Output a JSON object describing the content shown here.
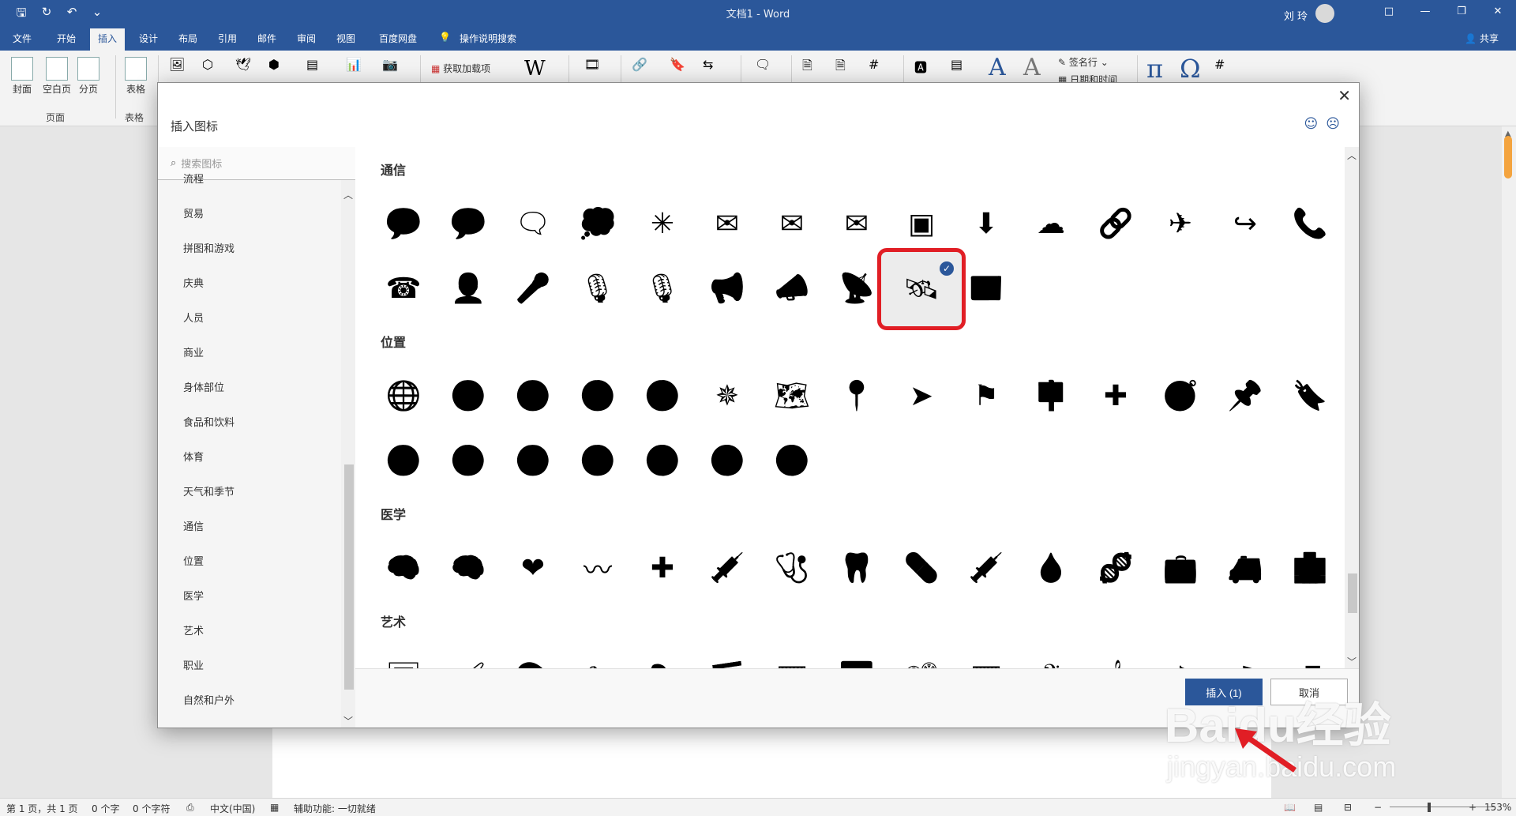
{
  "titlebar": {
    "title": "文档1  -  Word",
    "user": "刘 玲",
    "qa_icons": [
      "save-icon",
      "redo-icon",
      "undo-icon",
      "customize-icon"
    ],
    "win_buttons": [
      "□",
      "—",
      "❐",
      "✕"
    ]
  },
  "tabs": [
    "文件",
    "开始",
    "插入",
    "设计",
    "布局",
    "引用",
    "邮件",
    "审阅",
    "视图",
    "百度网盘",
    "操作说明搜索"
  ],
  "share_label": "共享",
  "ribbon": {
    "pages_items": [
      "封面",
      "空白页",
      "分页"
    ],
    "pages_group": "页面",
    "table_item": "表格",
    "table_group": "表格",
    "addins_label": "获取加载项",
    "wiki_label": "W",
    "signature_label": "签名行",
    "datetime_label": "日期和时间",
    "pi_label": "π",
    "omega_label": "Ω"
  },
  "dialog": {
    "title": "插入图标",
    "search_placeholder": "搜索图标",
    "categories": [
      "流程",
      "贸易",
      "拼图和游戏",
      "庆典",
      "人员",
      "商业",
      "身体部位",
      "食品和饮料",
      "体育",
      "天气和季节",
      "通信",
      "位置",
      "医学",
      "艺术",
      "职业",
      "自然和户外"
    ],
    "sections": [
      {
        "title": "通信",
        "icons": [
          [
            "💬",
            "💬",
            "🗨",
            "💭",
            "✳",
            "✉",
            "✉",
            "✉",
            "▣",
            "⬇",
            "☁",
            "🔗",
            "✈",
            "↪",
            "📞"
          ],
          [
            "☎",
            "👤",
            "🎤",
            "🎙",
            "🎙",
            "📢",
            "📣",
            "📡",
            "🛰",
            "📰"
          ]
        ]
      },
      {
        "title": "位置",
        "icons": [
          [
            "🌐",
            "🌍",
            "🌍",
            "🌏",
            "🌏",
            "✵",
            "🗺",
            "📍",
            "➤",
            "⚑",
            "🪧",
            "✚",
            "🧭",
            "📌",
            "🔖"
          ],
          [
            "🌍",
            "🌏",
            "🌍",
            "🌏",
            "🌎",
            "🌎",
            "🌎"
          ]
        ]
      },
      {
        "title": "医学",
        "icons": [
          [
            "🧠",
            "🧠",
            "❤",
            "〰",
            "✚",
            "💉",
            "🩺",
            "🦷",
            "💊",
            "💉",
            "🩸",
            "🧬",
            "💼",
            "🚑",
            "🏥"
          ]
        ]
      },
      {
        "title": "艺术",
        "icons": [
          [
            "🖼",
            "🖌",
            "🎨",
            "✎",
            "🎭",
            "🎬",
            "🎞",
            "🎦",
            "📽",
            "🎞",
            "𝄢",
            "𝄞",
            "♪",
            "♫",
            "♬"
          ]
        ]
      }
    ],
    "selected_label": "✓",
    "insert_button": "插入 (1)",
    "cancel_button": "取消"
  },
  "statusbar": {
    "page": "第 1 页，共 1 页",
    "words": "0 个字",
    "chars": "0 个字符",
    "lang": "中文(中国)",
    "accessibility": "辅助功能: 一切就绪",
    "zoom": "153%"
  },
  "watermark": {
    "main": "Baidu经验",
    "sub": "jingyan.baidu.com"
  }
}
